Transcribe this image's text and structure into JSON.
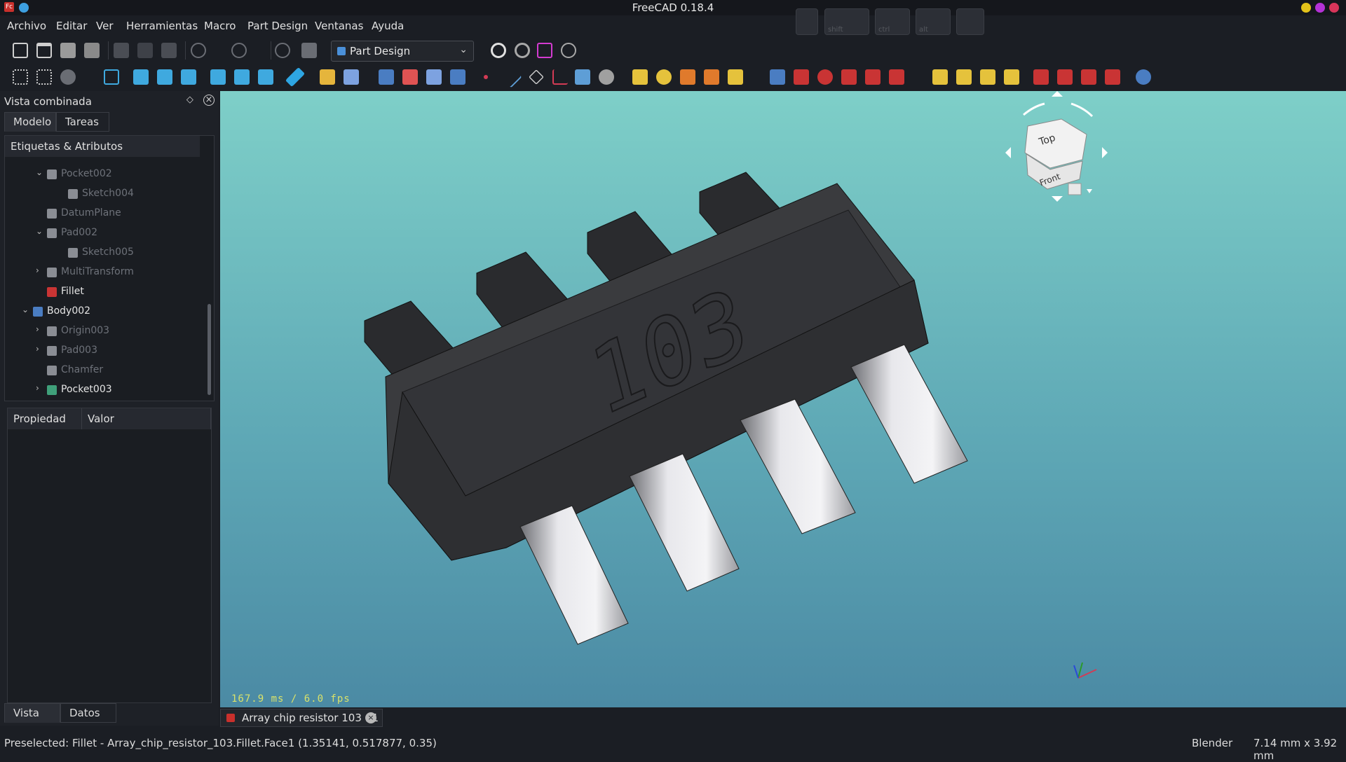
{
  "window": {
    "title": "FreeCAD 0.18.4"
  },
  "keys": [
    "shift",
    "ctrl",
    "alt"
  ],
  "menu": [
    "Archivo",
    "Editar",
    "Ver",
    "Herramientas",
    "Macro",
    "Part Design",
    "Ventanas",
    "Ayuda"
  ],
  "workbench": {
    "selected": "Part Design"
  },
  "combo": {
    "title": "Vista combinada",
    "tabs": [
      "Modelo",
      "Tareas"
    ],
    "tree_header": "Etiquetas & Atributos",
    "tree": [
      {
        "label": "Pocket002",
        "state": "dim",
        "expander": "open"
      },
      {
        "label": "Sketch004",
        "state": "dim",
        "expander": "none"
      },
      {
        "label": "DatumPlane",
        "state": "dim",
        "expander": "none"
      },
      {
        "label": "Pad002",
        "state": "dim",
        "expander": "open"
      },
      {
        "label": "Sketch005",
        "state": "dim",
        "expander": "none"
      },
      {
        "label": "MultiTransform",
        "state": "dim",
        "expander": "closed"
      },
      {
        "label": "Fillet",
        "state": "bright",
        "expander": "none"
      },
      {
        "label": "Body002",
        "state": "bright",
        "expander": "open"
      },
      {
        "label": "Origin003",
        "state": "dim",
        "expander": "closed"
      },
      {
        "label": "Pad003",
        "state": "dim",
        "expander": "closed"
      },
      {
        "label": "Chamfer",
        "state": "dim",
        "expander": "none"
      },
      {
        "label": "Pocket003",
        "state": "bright",
        "expander": "closed"
      }
    ],
    "props_headers": [
      "Propiedad",
      "Valor"
    ],
    "bottom_tabs": [
      "Vista",
      "Datos"
    ]
  },
  "navcube": {
    "top": "Top",
    "front": "Front"
  },
  "model": {
    "marking": "103"
  },
  "viewport": {
    "fps": "167.9 ms / 6.0 fps"
  },
  "document_tab": {
    "label": "Array chip resistor 103 : 1"
  },
  "status": {
    "message": "Preselected: Fillet - Array_chip_resistor_103.Fillet.Face1 (1.35141, 0.517877, 0.35)",
    "nav_style": "Blender",
    "dimensions": "7.14 mm x 3.92 mm"
  },
  "colors": {
    "bg_top": "#7ecfc8",
    "bg_bottom": "#4b8aa4",
    "body": "#3a3b3e",
    "terminal": "#e8e8ec",
    "fps_text": "#d9e26a"
  }
}
